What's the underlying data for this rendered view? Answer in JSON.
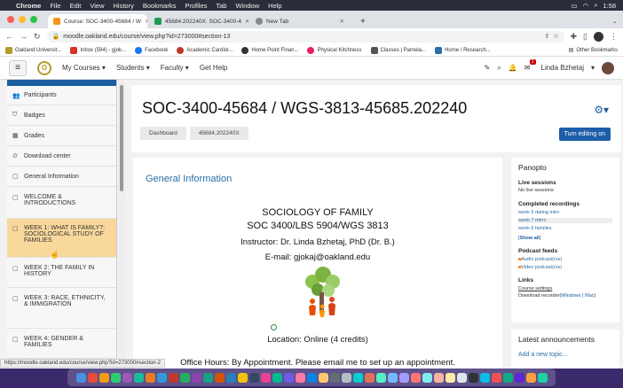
{
  "menubar": {
    "apple": "",
    "app": "Chrome",
    "items": [
      "File",
      "Edit",
      "View",
      "History",
      "Bookmarks",
      "Profiles",
      "Tab",
      "Window",
      "Help"
    ],
    "clock": "1:58"
  },
  "tabs": [
    {
      "label": "Course: SOC-3400-45684 / W",
      "color": "#f7931e"
    },
    {
      "label": "45684.202240X: SOC-3400-4",
      "color": "#1d9d4f"
    },
    {
      "label": "New Tab",
      "color": "#888"
    }
  ],
  "toolbar": {
    "url": "moodle.oakland.edu/course/view.php?id=273000#section-13"
  },
  "bookmarks": [
    {
      "label": "Oakland Universit...",
      "color": "#b59a2b"
    },
    {
      "label": "Inbox (594) - gjok...",
      "color": "#d93025"
    },
    {
      "label": "Facebook",
      "color": "#1877f2"
    },
    {
      "label": "Academic Cardiol...",
      "color": "#c0392b"
    },
    {
      "label": "Home Point Finan...",
      "color": "#333"
    },
    {
      "label": "Physical Kitchness",
      "color": "#e91e63"
    },
    {
      "label": "Classes | Pamela...",
      "color": "#555"
    },
    {
      "label": "Home / Research...",
      "color": "#2a6fa8"
    }
  ],
  "bookmarks_other": "Other Bookmarks",
  "navbar": {
    "links": [
      "My Courses",
      "Students",
      "Faculty",
      "Get Help"
    ],
    "user": "Linda Bzhetaj",
    "notif_count": "1"
  },
  "drawer": [
    {
      "icon": "👥",
      "label": "Participants"
    },
    {
      "icon": "⛉",
      "label": "Badges"
    },
    {
      "icon": "▦",
      "label": "Grades"
    },
    {
      "icon": "⊙",
      "label": "Download center"
    },
    {
      "icon": "▢",
      "label": "General Information"
    },
    {
      "icon": "▢",
      "label": "WELCOME & INTRODUCTIONS"
    },
    {
      "icon": "▢",
      "label": "WEEK 1: WHAT IS FAMILY?: SOCIOLOGICAL STUDY OF FAMILIES",
      "active": true
    },
    {
      "icon": "▢",
      "label": "WEEK 2: THE FAMILY IN HISTORY"
    },
    {
      "icon": "▢",
      "label": "WEEK 3: RACE, ETHNICITY, & IMMIGRATION"
    },
    {
      "icon": "▢",
      "label": "WEEK 4: GENDER & FAMILIES"
    }
  ],
  "header": {
    "title": "SOC-3400-45684 / WGS-3813-45685.202240",
    "crumbs": [
      "Dashboard",
      "45684.202240X"
    ],
    "edit_button": "Turn editing on"
  },
  "section": {
    "title": "General Information",
    "line1": "SOCIOLOGY OF FAMILY",
    "line2": "SOC 3400/LBS 5904/WGS 3813",
    "line3": "Instructor: Dr. Linda Bzhetaj, PhD (Dr. B.)",
    "line4": "E-mail: gjokaj@oakland.edu",
    "location": "Location: Online  (4 credits)",
    "office": "Office Hours: By Appointment. Please email me to set up an appointment."
  },
  "panopto": {
    "title": "Panopto",
    "live_heading": "Live sessions",
    "live_text": "No live sessions",
    "completed_heading": "Completed recordings",
    "recordings": [
      "week 6 dating intro",
      "week 7 mtrrc",
      "week 6 families"
    ],
    "show_all": "Show all",
    "feeds_heading": "Podcast feeds",
    "feeds": [
      "Audio podcast(rss)",
      "Video podcast(rss)"
    ],
    "links_heading": "Links",
    "course_settings": "Course settings",
    "download_recorder": "Download recorder",
    "download_windows": "Windows",
    "download_sep": " | ",
    "download_mac": "Mac"
  },
  "announcements": {
    "title": "Latest announcements",
    "add": "Add a new topic..."
  },
  "statusbar": "https://moodle.oakland.edu/course/view.php?id=273000#section-2",
  "dock_colors": [
    "#4a90e2",
    "#e74c3c",
    "#f39c12",
    "#2ecc71",
    "#9b59b6",
    "#1abc9c",
    "#e67e22",
    "#3498db",
    "#c0392b",
    "#27ae60",
    "#8e44ad",
    "#16a085",
    "#d35400",
    "#2980b9",
    "#f1c40f",
    "#34495e",
    "#e84393",
    "#00b894",
    "#6c5ce7",
    "#fd79a8",
    "#0984e3",
    "#fdcb6e",
    "#636e72",
    "#b2bec3",
    "#00cec9",
    "#e17055",
    "#55efc4",
    "#74b9ff",
    "#a29bfe",
    "#ff7675",
    "#81ecec",
    "#fab1a0",
    "#ffeaa7",
    "#dfe6e9",
    "#2d3436",
    "#0abde3",
    "#ee5253",
    "#10ac84",
    "#5f27cd",
    "#ff9f43",
    "#1dd1a1"
  ]
}
